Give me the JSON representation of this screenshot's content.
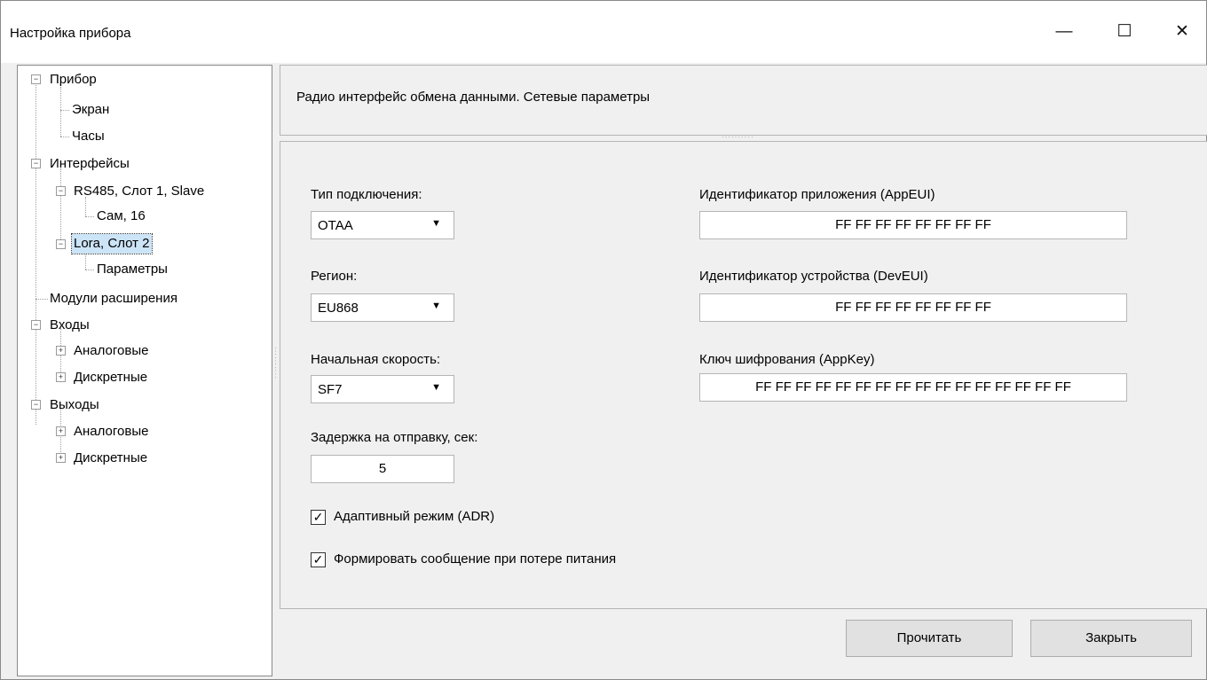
{
  "window": {
    "title": "Настройка прибора",
    "minimize_glyph": "—",
    "maximize_glyph": "☐",
    "close_glyph": "✕"
  },
  "tree": {
    "items": [
      {
        "label": "Прибор",
        "expand": "−"
      },
      {
        "label": "Экран"
      },
      {
        "label": "Часы"
      },
      {
        "label": "Интерфейсы",
        "expand": "−"
      },
      {
        "label": "RS485, Слот 1, Slave",
        "expand": "−"
      },
      {
        "label": "Сам, 16"
      },
      {
        "label": "Lora, Слот 2",
        "expand": "−",
        "selected": true
      },
      {
        "label": "Параметры"
      },
      {
        "label": "Модули расширения"
      },
      {
        "label": "Входы",
        "expand": "−"
      },
      {
        "label": "Аналоговые",
        "expand": "+"
      },
      {
        "label": "Дискретные",
        "expand": "+"
      },
      {
        "label": "Выходы",
        "expand": "−"
      },
      {
        "label": "Аналоговые",
        "expand": "+"
      },
      {
        "label": "Дискретные",
        "expand": "+"
      }
    ]
  },
  "header": {
    "text": "Радио интерфейс обмена данными. Сетевые параметры"
  },
  "form": {
    "connection_type": {
      "label": "Тип подключения:",
      "value": "OTAA"
    },
    "region": {
      "label": "Регион:",
      "value": "EU868"
    },
    "start_speed": {
      "label": "Начальная скорость:",
      "value": "SF7"
    },
    "send_delay": {
      "label": "Задержка на отправку, сек:",
      "value": "5"
    },
    "app_eui": {
      "label": "Идентификатор приложения (AppEUI)",
      "value": "FF FF FF FF FF FF FF FF"
    },
    "dev_eui": {
      "label": "Идентификатор устройства (DevEUI)",
      "value": "FF FF FF FF FF FF FF FF"
    },
    "app_key": {
      "label": "Ключ шифрования (AppKey)",
      "value": "FF FF FF FF FF FF FF FF FF FF FF FF FF FF FF FF"
    },
    "adr": {
      "label": "Адаптивный режим (ADR)",
      "checked": true,
      "mark": "✓"
    },
    "power_loss": {
      "label": "Формировать сообщение при потере питания",
      "checked": true,
      "mark": "✓"
    },
    "dropdown_arrow": "▼"
  },
  "buttons": {
    "read": "Прочитать",
    "close": "Закрыть"
  },
  "splitter": {
    "grip": "··········"
  }
}
